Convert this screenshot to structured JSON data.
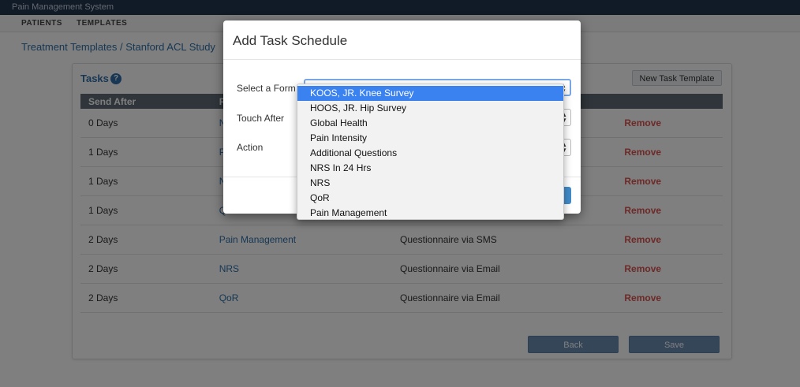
{
  "app": {
    "title": "Pain Management System"
  },
  "nav": {
    "patients": "PATIENTS",
    "templates": "TEMPLATES"
  },
  "breadcrumb": {
    "parent": "Treatment Templates",
    "separator": " / ",
    "current": "Stanford ACL Study"
  },
  "tasks": {
    "title": "Tasks",
    "help_icon": "?",
    "new_template_label": "New Task Template",
    "columns": [
      "Send After",
      "Fo",
      "",
      ""
    ],
    "rows": [
      {
        "send_after": "0 Days",
        "form": "NR",
        "action": "",
        "remove": "Remove"
      },
      {
        "send_after": "1 Days",
        "form": "Pa",
        "action": "",
        "remove": "Remove"
      },
      {
        "send_after": "1 Days",
        "form": "NI",
        "action": "",
        "remove": "Remove"
      },
      {
        "send_after": "1 Days",
        "form": "Q",
        "action": "",
        "remove": "Remove"
      },
      {
        "send_after": "2 Days",
        "form": "Pain Management",
        "action": "Questionnaire via SMS",
        "remove": "Remove"
      },
      {
        "send_after": "2 Days",
        "form": "NRS",
        "action": "Questionnaire via Email",
        "remove": "Remove"
      },
      {
        "send_after": "2 Days",
        "form": "QoR",
        "action": "Questionnaire via Email",
        "remove": "Remove"
      }
    ],
    "back_label": "Back",
    "save_label": "Save"
  },
  "modal": {
    "title": "Add Task Schedule",
    "select_form_label": "Select a Form",
    "touch_after_label": "Touch After",
    "action_label": "Action"
  },
  "dropdown": {
    "selected_index": 0,
    "options": [
      "KOOS, JR. Knee Survey",
      "HOOS, JR. Hip Survey",
      "Global Health",
      "Pain Intensity",
      "Additional Questions",
      "NRS In 24 Hrs",
      "NRS",
      "QoR",
      "Pain Management"
    ]
  },
  "colors": {
    "accent": "#2f6fa8",
    "selected_option": "#3b82f1",
    "remove": "#d9534f",
    "header": "#5f6a75"
  }
}
